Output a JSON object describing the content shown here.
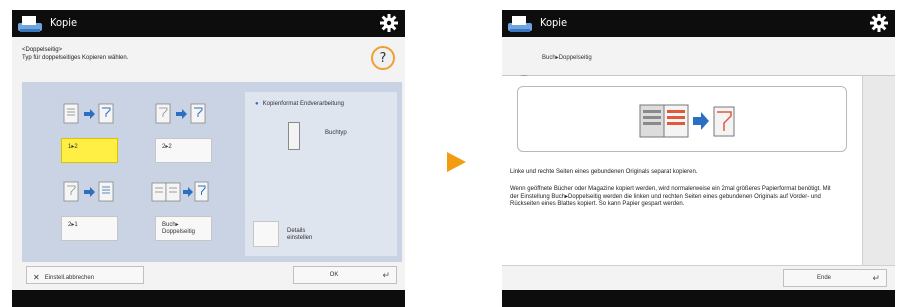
{
  "colors": {
    "titlebar": "#0d0d0d",
    "panel": "#c9d3e3",
    "selected_option": "#ffef45",
    "help_highlight": "#f0a030",
    "arrow": "#f39c12",
    "illustration_left_page": "#d9d9d9",
    "illustration_right_page": "#e05a3a",
    "illustration_arrow": "#2c6fc2"
  },
  "left_screen": {
    "title": "Kopie",
    "icons": {
      "app": "copier-icon",
      "settings": "gear-icon",
      "help": "help-icon"
    },
    "instruction_line1": "<Doppelseitig>",
    "instruction_line2": "Typ für doppelseitiges Kopieren wählen.",
    "help_label": "?",
    "options": [
      {
        "label": "1▸2",
        "selected": true,
        "icon": "one-to-two-sided-icon"
      },
      {
        "label": "2▸2",
        "selected": false,
        "icon": "two-to-two-sided-icon"
      },
      {
        "label": "2▸1",
        "selected": false,
        "icon": "two-to-one-sided-icon"
      },
      {
        "label_line1": "Buch▸",
        "label_line2": "Doppelseitig",
        "selected": false,
        "icon": "book-to-two-sided-icon"
      }
    ],
    "finishing": {
      "title": "Kopienformat Endverarbeitung",
      "value": "Buchtyp",
      "details_label_line1": "Details",
      "details_label_line2": "einstellen"
    },
    "cancel_label": "Einstell.abbrechen",
    "ok_label": "OK"
  },
  "right_screen": {
    "title": "Kopie",
    "icons": {
      "app": "copier-icon",
      "settings": "gear-icon",
      "help": "help-icon"
    },
    "help_label": "?",
    "topic": "Buch▸Doppelseitig",
    "description_short": "Linke und rechte Seiten eines gebundenen Originals separat kopieren.",
    "description_long": "Wenn geöffnete Bücher oder Magazine kopiert werden, wird normalerweise ein 2mal größeres Papierformat benötigt. Mit der Einstellung Buch▸Doppelseitig werden die linken und rechten Seiten eines gebundenen Originals auf Vorder- und Rückseiten eines Blattes kopiert. So kann Papier gespart werden.",
    "close_label": "Ende"
  },
  "navigation": {
    "next_arrow_icon": "next-step-arrow-icon"
  }
}
